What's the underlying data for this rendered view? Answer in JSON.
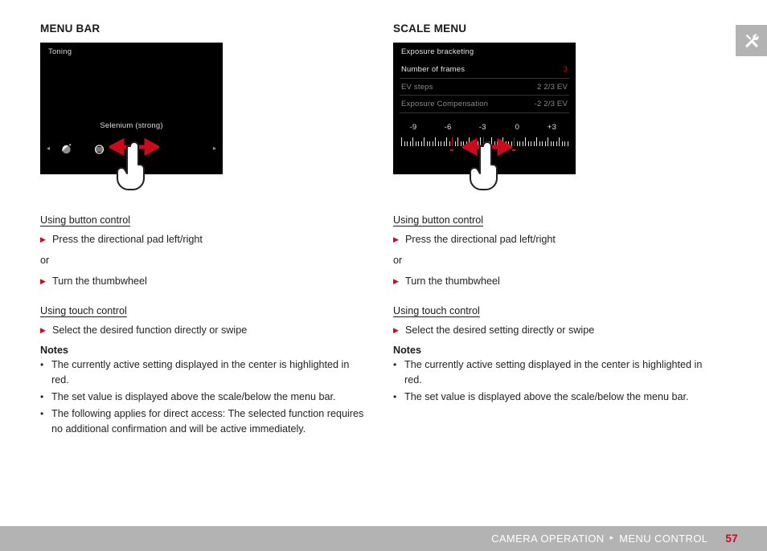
{
  "badge": {
    "icon": "tools-icon"
  },
  "columns": [
    {
      "heading": "MENU BAR",
      "screen": {
        "type": "menu-bar",
        "title": "Toning",
        "value": "Selenium (strong)",
        "chevron_left": "◂",
        "chevron_right": "▸",
        "icons": [
          {
            "name": "toning-sepia-icon",
            "state": "inactive-filled"
          },
          {
            "name": "toning-blue-icon",
            "state": "inactive-outline"
          },
          {
            "name": "toning-selenium-icon",
            "state": "active-red"
          }
        ],
        "gesture": "swipe-left-right-hand-icon"
      },
      "sections": [
        {
          "heading": "Using button control",
          "steps": [
            "Press the directional pad left/right"
          ],
          "connector": "or",
          "steps2": [
            "Turn the thumbwheel"
          ]
        },
        {
          "heading": "Using touch control",
          "steps": [
            "Select the desired function directly or swipe"
          ]
        }
      ],
      "notes_heading": "Notes",
      "notes": [
        "The currently active setting displayed in the center is highlighted in red.",
        "The set value is displayed above the scale/below the menu bar.",
        "The following applies for direct access: The selected function requires no additional confirmation and will be active immediately."
      ]
    },
    {
      "heading": "SCALE MENU",
      "screen": {
        "type": "scale-menu",
        "rows": [
          {
            "label": "Exposure bracketing",
            "value": ""
          },
          {
            "label": "Number of frames",
            "value": "3"
          },
          {
            "label": "EV steps",
            "value": "2 2/3 EV"
          },
          {
            "label": "Exposure Compensation",
            "value": "-2 2/3 EV"
          }
        ],
        "scale_labels": [
          "-9",
          "-6",
          "-3",
          "0",
          "+3"
        ],
        "gesture": "swipe-left-right-hand-icon"
      },
      "sections": [
        {
          "heading": "Using button control",
          "steps": [
            "Press the directional pad left/right"
          ],
          "connector": "or",
          "steps2": [
            "Turn the thumbwheel"
          ]
        },
        {
          "heading": "Using touch control",
          "steps": [
            "Select the desired setting directly or swipe"
          ]
        }
      ],
      "notes_heading": "Notes",
      "notes": [
        "The currently active setting displayed in the center is highlighted in red.",
        "The set value is displayed above the scale/below the menu bar."
      ]
    }
  ],
  "footer": {
    "crumb1": "CAMERA OPERATION",
    "separator": "▸",
    "crumb2": "MENU CONTROL",
    "page": "57"
  },
  "colors": {
    "accent_red": "#cc0a1e",
    "screen_black": "#000000",
    "footer_gray": "#b3b3b3"
  }
}
